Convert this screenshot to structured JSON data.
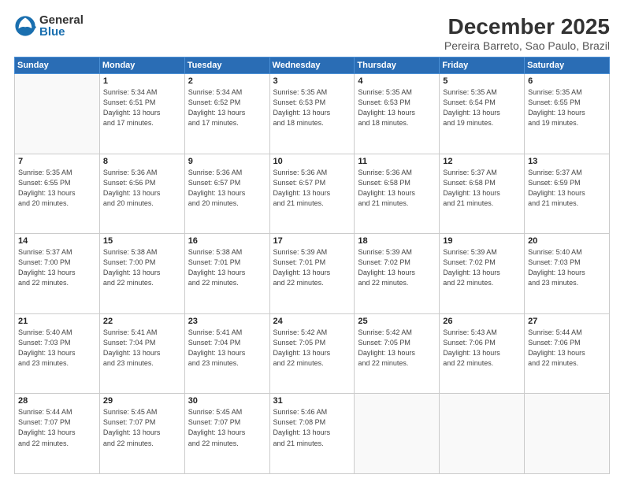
{
  "logo": {
    "general": "General",
    "blue": "Blue"
  },
  "title": "December 2025",
  "subtitle": "Pereira Barreto, Sao Paulo, Brazil",
  "days_header": [
    "Sunday",
    "Monday",
    "Tuesday",
    "Wednesday",
    "Thursday",
    "Friday",
    "Saturday"
  ],
  "weeks": [
    [
      {
        "day": "",
        "info": ""
      },
      {
        "day": "1",
        "info": "Sunrise: 5:34 AM\nSunset: 6:51 PM\nDaylight: 13 hours\nand 17 minutes."
      },
      {
        "day": "2",
        "info": "Sunrise: 5:34 AM\nSunset: 6:52 PM\nDaylight: 13 hours\nand 17 minutes."
      },
      {
        "day": "3",
        "info": "Sunrise: 5:35 AM\nSunset: 6:53 PM\nDaylight: 13 hours\nand 18 minutes."
      },
      {
        "day": "4",
        "info": "Sunrise: 5:35 AM\nSunset: 6:53 PM\nDaylight: 13 hours\nand 18 minutes."
      },
      {
        "day": "5",
        "info": "Sunrise: 5:35 AM\nSunset: 6:54 PM\nDaylight: 13 hours\nand 19 minutes."
      },
      {
        "day": "6",
        "info": "Sunrise: 5:35 AM\nSunset: 6:55 PM\nDaylight: 13 hours\nand 19 minutes."
      }
    ],
    [
      {
        "day": "7",
        "info": "Sunrise: 5:35 AM\nSunset: 6:55 PM\nDaylight: 13 hours\nand 20 minutes."
      },
      {
        "day": "8",
        "info": "Sunrise: 5:36 AM\nSunset: 6:56 PM\nDaylight: 13 hours\nand 20 minutes."
      },
      {
        "day": "9",
        "info": "Sunrise: 5:36 AM\nSunset: 6:57 PM\nDaylight: 13 hours\nand 20 minutes."
      },
      {
        "day": "10",
        "info": "Sunrise: 5:36 AM\nSunset: 6:57 PM\nDaylight: 13 hours\nand 21 minutes."
      },
      {
        "day": "11",
        "info": "Sunrise: 5:36 AM\nSunset: 6:58 PM\nDaylight: 13 hours\nand 21 minutes."
      },
      {
        "day": "12",
        "info": "Sunrise: 5:37 AM\nSunset: 6:58 PM\nDaylight: 13 hours\nand 21 minutes."
      },
      {
        "day": "13",
        "info": "Sunrise: 5:37 AM\nSunset: 6:59 PM\nDaylight: 13 hours\nand 21 minutes."
      }
    ],
    [
      {
        "day": "14",
        "info": "Sunrise: 5:37 AM\nSunset: 7:00 PM\nDaylight: 13 hours\nand 22 minutes."
      },
      {
        "day": "15",
        "info": "Sunrise: 5:38 AM\nSunset: 7:00 PM\nDaylight: 13 hours\nand 22 minutes."
      },
      {
        "day": "16",
        "info": "Sunrise: 5:38 AM\nSunset: 7:01 PM\nDaylight: 13 hours\nand 22 minutes."
      },
      {
        "day": "17",
        "info": "Sunrise: 5:39 AM\nSunset: 7:01 PM\nDaylight: 13 hours\nand 22 minutes."
      },
      {
        "day": "18",
        "info": "Sunrise: 5:39 AM\nSunset: 7:02 PM\nDaylight: 13 hours\nand 22 minutes."
      },
      {
        "day": "19",
        "info": "Sunrise: 5:39 AM\nSunset: 7:02 PM\nDaylight: 13 hours\nand 22 minutes."
      },
      {
        "day": "20",
        "info": "Sunrise: 5:40 AM\nSunset: 7:03 PM\nDaylight: 13 hours\nand 23 minutes."
      }
    ],
    [
      {
        "day": "21",
        "info": "Sunrise: 5:40 AM\nSunset: 7:03 PM\nDaylight: 13 hours\nand 23 minutes."
      },
      {
        "day": "22",
        "info": "Sunrise: 5:41 AM\nSunset: 7:04 PM\nDaylight: 13 hours\nand 23 minutes."
      },
      {
        "day": "23",
        "info": "Sunrise: 5:41 AM\nSunset: 7:04 PM\nDaylight: 13 hours\nand 23 minutes."
      },
      {
        "day": "24",
        "info": "Sunrise: 5:42 AM\nSunset: 7:05 PM\nDaylight: 13 hours\nand 22 minutes."
      },
      {
        "day": "25",
        "info": "Sunrise: 5:42 AM\nSunset: 7:05 PM\nDaylight: 13 hours\nand 22 minutes."
      },
      {
        "day": "26",
        "info": "Sunrise: 5:43 AM\nSunset: 7:06 PM\nDaylight: 13 hours\nand 22 minutes."
      },
      {
        "day": "27",
        "info": "Sunrise: 5:44 AM\nSunset: 7:06 PM\nDaylight: 13 hours\nand 22 minutes."
      }
    ],
    [
      {
        "day": "28",
        "info": "Sunrise: 5:44 AM\nSunset: 7:07 PM\nDaylight: 13 hours\nand 22 minutes."
      },
      {
        "day": "29",
        "info": "Sunrise: 5:45 AM\nSunset: 7:07 PM\nDaylight: 13 hours\nand 22 minutes."
      },
      {
        "day": "30",
        "info": "Sunrise: 5:45 AM\nSunset: 7:07 PM\nDaylight: 13 hours\nand 22 minutes."
      },
      {
        "day": "31",
        "info": "Sunrise: 5:46 AM\nSunset: 7:08 PM\nDaylight: 13 hours\nand 21 minutes."
      },
      {
        "day": "",
        "info": ""
      },
      {
        "day": "",
        "info": ""
      },
      {
        "day": "",
        "info": ""
      }
    ]
  ]
}
